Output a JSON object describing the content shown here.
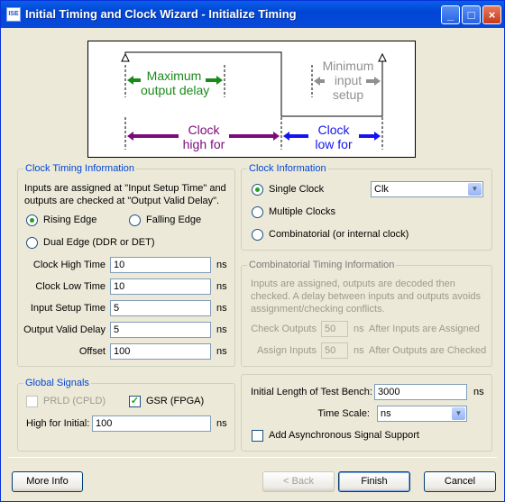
{
  "window": {
    "title": "Initial Timing and Clock Wizard - Initialize Timing",
    "icon_text": "ISE"
  },
  "diagram": {
    "max_output_delay": [
      "Maximum",
      "output delay"
    ],
    "min_input_setup": [
      "Minimum",
      "input",
      "setup"
    ],
    "clock_high_for": [
      "Clock",
      "high for"
    ],
    "clock_low_for": [
      "Clock",
      "low for"
    ]
  },
  "clock_timing": {
    "legend": "Clock Timing Information",
    "description_1": "Inputs are assigned at \"Input Setup Time\" and",
    "description_2": "outputs are checked at \"Output Valid Delay\".",
    "rising_edge": "Rising Edge",
    "falling_edge": "Falling Edge",
    "dual_edge": "Dual Edge (DDR or DET)",
    "fields": [
      {
        "label": "Clock High Time",
        "value": "10",
        "unit": "ns"
      },
      {
        "label": "Clock Low Time",
        "value": "10",
        "unit": "ns"
      },
      {
        "label": "Input Setup Time",
        "value": "5",
        "unit": "ns"
      },
      {
        "label": "Output Valid Delay",
        "value": "5",
        "unit": "ns"
      },
      {
        "label": "Offset",
        "value": "100",
        "unit": "ns"
      }
    ]
  },
  "clock_info": {
    "legend": "Clock Information",
    "single": "Single Clock",
    "multiple": "Multiple Clocks",
    "combinatorial": "Combinatorial (or internal clock)",
    "clock_select": "Clk"
  },
  "comb_timing": {
    "legend": "Combinatorial Timing Information",
    "description_1": "Inputs are assigned, outputs are decoded then",
    "description_2": "checked.  A delay between inputs and outputs avoids",
    "description_3": "assignment/checking conflicts.",
    "check_outputs": "Check Outputs",
    "check_value": "50",
    "check_after": "After Inputs are Assigned",
    "assign_inputs": "Assign Inputs",
    "assign_value": "50",
    "assign_after": "After Outputs are Checked",
    "unit": "ns"
  },
  "global_signals": {
    "legend": "Global Signals",
    "prld": "PRLD (CPLD)",
    "gsr": "GSR (FPGA)",
    "high_for_initial": "High for Initial:",
    "high_value": "100",
    "unit": "ns"
  },
  "testbench": {
    "length_label": "Initial Length of Test Bench:",
    "length_value": "3000",
    "unit": "ns",
    "time_scale_label": "Time Scale:",
    "time_scale_value": "ns",
    "async_label": "Add Asynchronous Signal Support"
  },
  "buttons": {
    "more_info": "More Info",
    "back": "< Back",
    "finish": "Finish",
    "cancel": "Cancel"
  },
  "colors": {
    "green": "#1a8a1a",
    "purple": "#7b0a7b",
    "blue": "#1414f0",
    "gray_arrow": "#909090"
  }
}
